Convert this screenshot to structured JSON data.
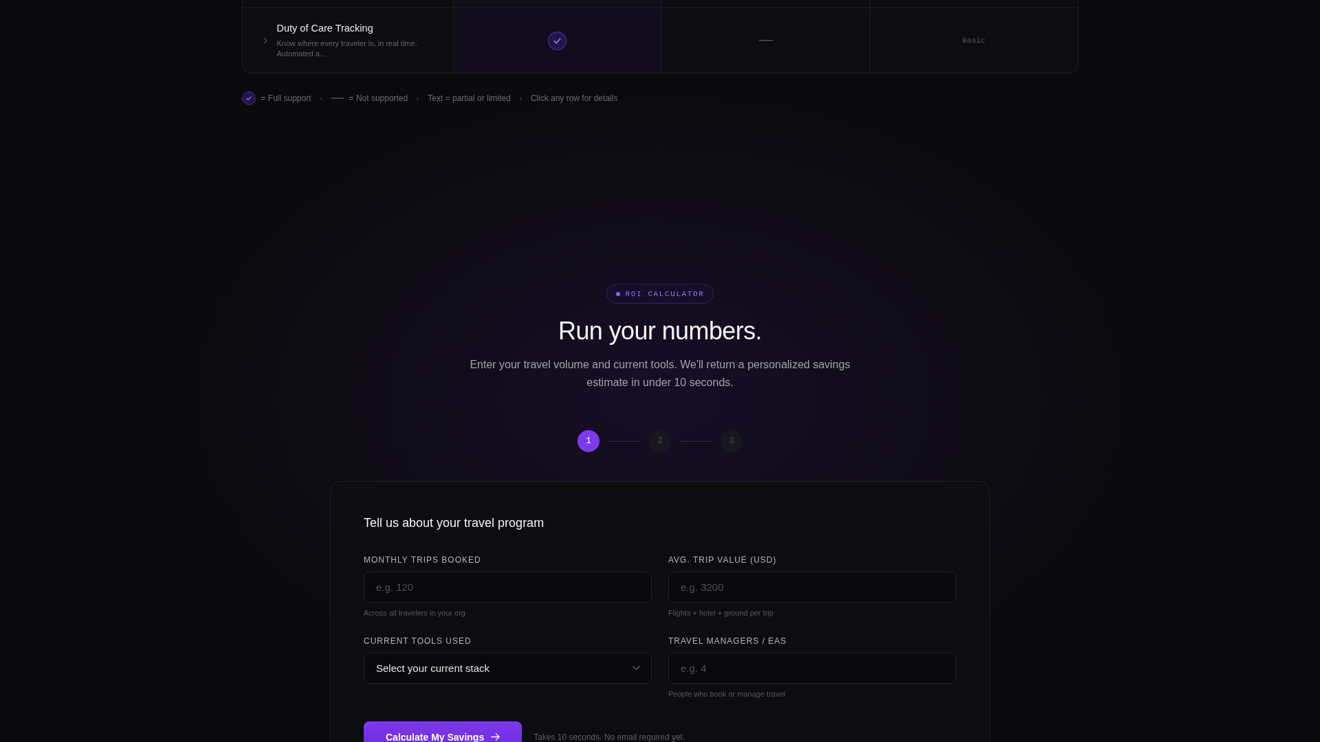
{
  "comparison_table": {
    "rows": [
      {
        "feature": "Duty of Care Tracking",
        "description": "Know where every traveler is, in real time. Automated a...",
        "expanded": false,
        "cells": [
          {
            "kind": "check",
            "highlighted": true
          },
          {
            "kind": "dash",
            "highlighted": false
          },
          {
            "kind": "text",
            "text": "Basic",
            "highlighted": false
          }
        ]
      }
    ]
  },
  "legend": [
    {
      "kind": "check",
      "label": "= Full support"
    },
    {
      "kind": "dash",
      "label": "= Not supported"
    },
    {
      "kind": "plain",
      "label": "Text = partial or limited"
    },
    {
      "kind": "plain",
      "label": "Click any row for details"
    }
  ],
  "roi_section": {
    "badge": "ROI CALCULATOR",
    "title": "Run your numbers.",
    "subtitle": "Enter your travel volume and current tools. We'll return a personalized savings estimate in under 10 seconds.",
    "steps": [
      {
        "label": "1",
        "selected": true
      },
      {
        "label": "2",
        "selected": false
      },
      {
        "label": "3",
        "selected": false
      }
    ],
    "form": {
      "title": "Tell us about your travel program",
      "fields": [
        {
          "kind": "input",
          "label": "MONTHLY TRIPS BOOKED",
          "placeholder": "e.g. 120",
          "hint": "Across all travelers in your org"
        },
        {
          "kind": "input",
          "label": "AVG. TRIP VALUE (USD)",
          "placeholder": "e.g. 3200",
          "hint": "Flights + hotel + ground per trip"
        },
        {
          "kind": "select",
          "label": "CURRENT TOOLS USED",
          "value": "Select your current stack"
        },
        {
          "kind": "input",
          "label": "TRAVEL MANAGERS / EAS",
          "placeholder": "e.g. 4",
          "hint": "People who book or manage travel"
        }
      ],
      "submit": "Calculate My Savings",
      "note": "Takes 10 seconds. No email required yet."
    }
  }
}
